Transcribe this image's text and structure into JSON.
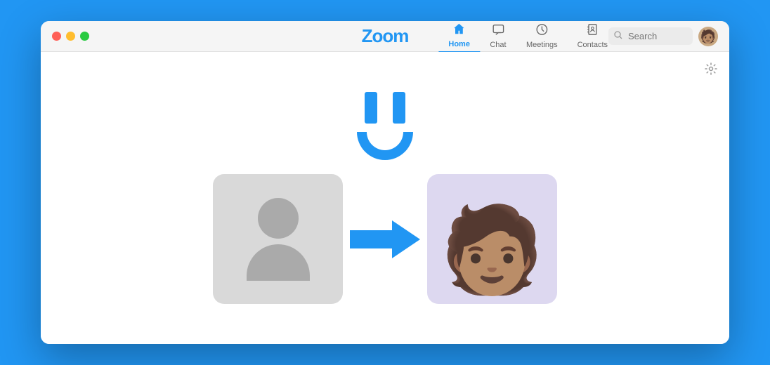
{
  "app": {
    "title": "Zoom"
  },
  "window_controls": {
    "close_label": "",
    "minimize_label": "",
    "maximize_label": ""
  },
  "nav": {
    "tabs": [
      {
        "id": "home",
        "label": "Home",
        "active": true
      },
      {
        "id": "chat",
        "label": "Chat",
        "active": false
      },
      {
        "id": "meetings",
        "label": "Meetings",
        "active": false
      },
      {
        "id": "contacts",
        "label": "Contacts",
        "active": false
      }
    ]
  },
  "search": {
    "placeholder": "Search"
  },
  "settings": {
    "label": "⚙"
  },
  "illustration": {
    "arrow_label": "→"
  }
}
